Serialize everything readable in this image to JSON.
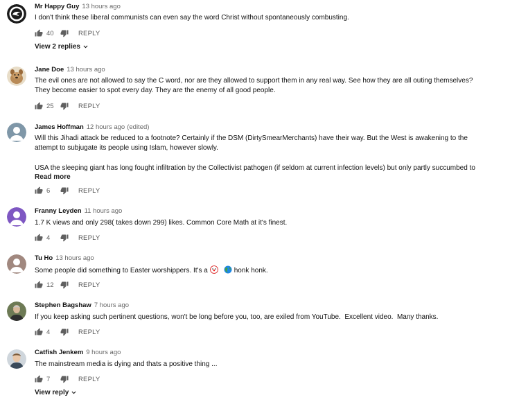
{
  "comments": [
    {
      "author": "Mr Happy Guy",
      "time": "13 hours ago",
      "edited": "",
      "lines": [
        "I don't think these liberal communists can even say the word Christ without spontaneously combusting."
      ],
      "likes": "40",
      "reply_label": "REPLY",
      "view_replies": "View 2 replies",
      "avatar_icon": "avatar-logo-icon"
    },
    {
      "author": "Jane Doe",
      "time": "13 hours ago",
      "edited": "",
      "lines": [
        "The evil ones are not allowed to say the C word, nor are they allowed to support them in any real way. See how they are all outing themselves?",
        "They become easier to spot every day. They are the enemy of all good people."
      ],
      "likes": "25",
      "reply_label": "REPLY",
      "avatar_icon": "avatar-animal-icon"
    },
    {
      "author": "James Hoffman",
      "time": "12 hours ago",
      "edited": "(edited)",
      "lines": [
        "Will this Jihadi attack be reduced to a footnote? Certainly if the DSM (DirtySmearMerchants) have their way. But the West is awakening to the",
        "attempt to subjugate its people using Islam, however slowly.",
        "",
        "USA the sleeping giant has long fought infiltration by the Collectivist pathogen (if seldom at current infection levels) but only partly succumbed to"
      ],
      "read_more": "Read more",
      "likes": "6",
      "reply_label": "REPLY",
      "avatar_icon": "avatar-default-icon"
    },
    {
      "author": "Franny Leyden",
      "time": "11 hours ago",
      "edited": "",
      "lines": [
        "1.7 K views and only 298( takes down 299) likes. Common Core Math at it's finest."
      ],
      "likes": "4",
      "reply_label": "REPLY",
      "avatar_icon": "avatar-default-icon"
    },
    {
      "author": "Tu Ho",
      "time": "13 hours ago",
      "edited": "",
      "text_before": "Some people did something to Easter worshippers. It's a",
      "text_after": "honk honk.",
      "likes": "12",
      "reply_label": "REPLY",
      "avatar_icon": "avatar-default-icon"
    },
    {
      "author": "Stephen Bagshaw",
      "time": "7 hours ago",
      "edited": "",
      "lines": [
        "If you keep asking such pertinent questions, won't be long before you, too, are exiled from YouTube.  Excellent video.  Many thanks."
      ],
      "likes": "4",
      "reply_label": "REPLY",
      "avatar_icon": "avatar-photo-icon"
    },
    {
      "author": "Catfish Jenkem",
      "time": "9 hours ago",
      "edited": "",
      "lines": [
        "The mainstream media is dying and thats a positive thing ..."
      ],
      "likes": "7",
      "reply_label": "REPLY",
      "view_replies": "View reply",
      "avatar_icon": "avatar-photo-icon"
    }
  ],
  "colors": {
    "avatar_gray": "#7f97a8",
    "avatar_purple": "#7e57c2",
    "avatar_brown": "#a1887f"
  }
}
